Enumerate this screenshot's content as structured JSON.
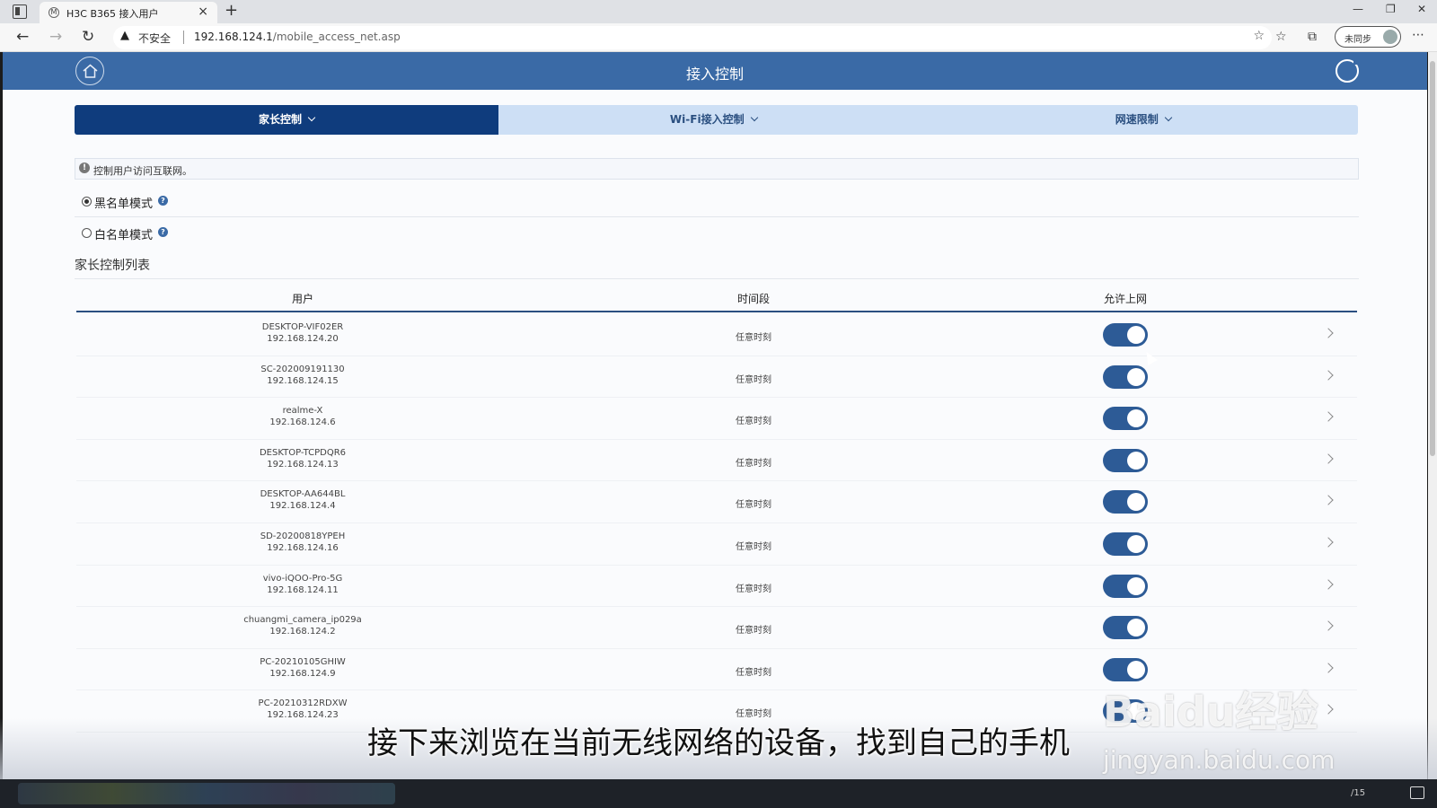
{
  "browser": {
    "tab_title": "H3C B365 接入用户",
    "insecure_label": "不安全",
    "url_host": "192.168.124.1",
    "url_path": "/mobile_access_net.asp",
    "sync_label": "未同步"
  },
  "header": {
    "title": "接入控制"
  },
  "tabs": [
    {
      "label": "家长控制"
    },
    {
      "label": "Wi-Fi接入控制"
    },
    {
      "label": "网速限制"
    }
  ],
  "notice": "控制用户访问互联网。",
  "modes": {
    "blacklist": {
      "label": "黑名单模式",
      "selected": true
    },
    "whitelist": {
      "label": "白名单模式",
      "selected": false
    }
  },
  "section_title": "家长控制列表",
  "table": {
    "headers": {
      "user": "用户",
      "time": "时间段",
      "allow": "允许上网"
    },
    "rows": [
      {
        "name": "DESKTOP-VIF02ER",
        "ip": "192.168.124.20",
        "time": "任意时刻",
        "allowed": true
      },
      {
        "name": "SC-202009191130",
        "ip": "192.168.124.15",
        "time": "任意时刻",
        "allowed": true
      },
      {
        "name": "realme-X",
        "ip": "192.168.124.6",
        "time": "任意时刻",
        "allowed": true
      },
      {
        "name": "DESKTOP-TCPDQR6",
        "ip": "192.168.124.13",
        "time": "任意时刻",
        "allowed": true
      },
      {
        "name": "DESKTOP-AA644BL",
        "ip": "192.168.124.4",
        "time": "任意时刻",
        "allowed": true
      },
      {
        "name": "SD-20200818YPEH",
        "ip": "192.168.124.16",
        "time": "任意时刻",
        "allowed": true
      },
      {
        "name": "vivo-iQOO-Pro-5G",
        "ip": "192.168.124.11",
        "time": "任意时刻",
        "allowed": true
      },
      {
        "name": "chuangmi_camera_ip029a",
        "ip": "192.168.124.2",
        "time": "任意时刻",
        "allowed": true
      },
      {
        "name": "PC-20210105GHIW",
        "ip": "192.168.124.9",
        "time": "任意时刻",
        "allowed": true
      },
      {
        "name": "PC-20210312RDXW",
        "ip": "192.168.124.23",
        "time": "任意时刻",
        "allowed": true
      }
    ]
  },
  "overlay": {
    "subtitle": "接下来浏览在当前无线网络的设备，找到自己的手机",
    "watermark": "Baidu经验",
    "watermark_url": "jingyan.baidu.com"
  },
  "taskbar": {
    "clock": "/15"
  },
  "colors": {
    "header_blue": "#3a6aa6",
    "active_tab": "#0f3c7d",
    "toggle_on": "#2d5b96"
  }
}
